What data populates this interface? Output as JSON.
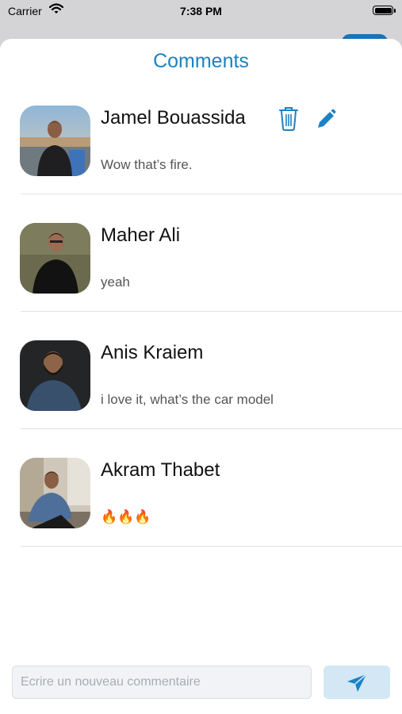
{
  "status_bar": {
    "carrier": "Carrier",
    "time": "7:38 PM"
  },
  "sheet": {
    "title": "Comments"
  },
  "comments": [
    {
      "author": "Jamel Bouassida",
      "text": "Wow that’s fire.",
      "actions": [
        "trash-icon",
        "pencil-icon"
      ]
    },
    {
      "author": "Maher Ali",
      "text": "yeah"
    },
    {
      "author": "Anis Kraiem",
      "text": "i love it, what’s the car model"
    },
    {
      "author": "Akram Thabet",
      "text": "🔥🔥🔥"
    }
  ],
  "composer": {
    "placeholder": "Ecrire un nouveau commentaire",
    "value": "",
    "send_icon": "paper-plane-icon"
  },
  "colors": {
    "accent": "#1b82c4",
    "send_bg": "#d3e7f5"
  }
}
